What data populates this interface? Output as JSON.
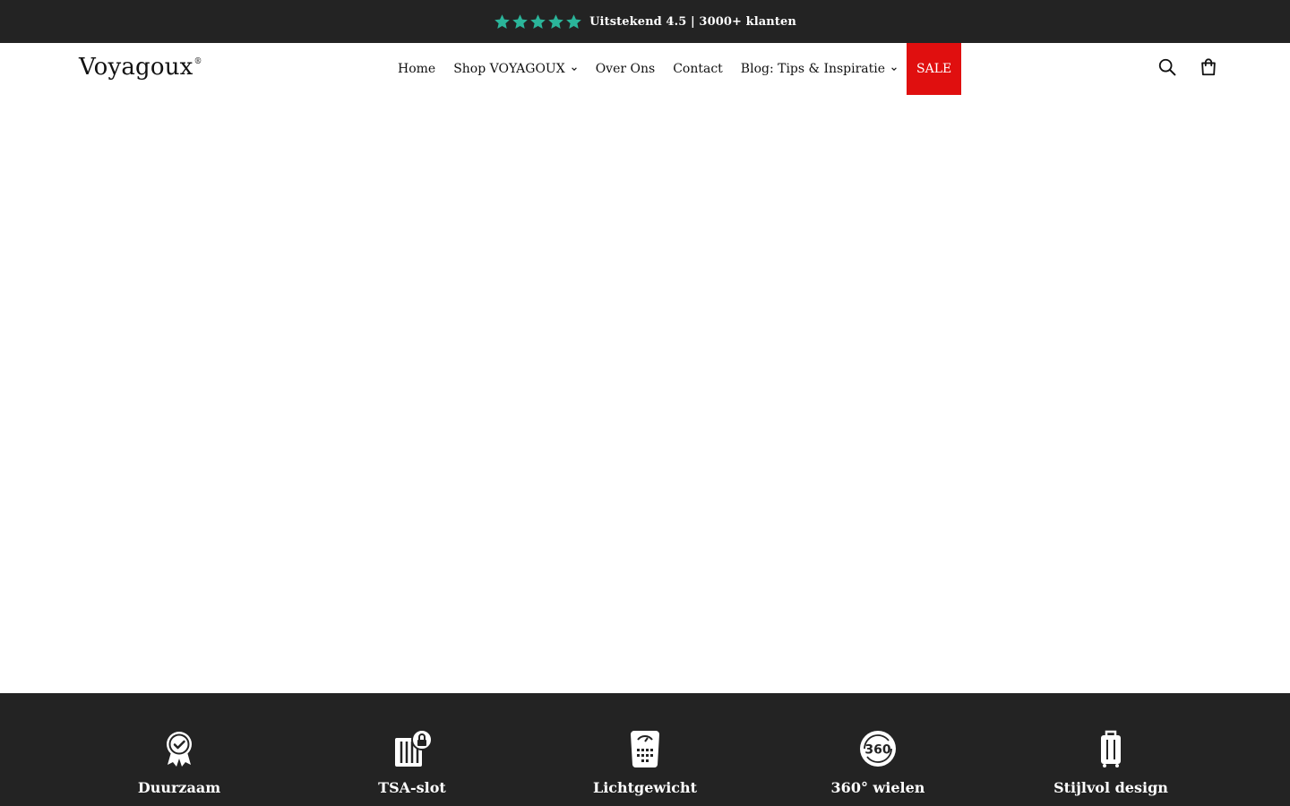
{
  "announcement": {
    "rating_stars": 5,
    "star_color": "#2bb59a",
    "text": "Uitstekend 4.5 | 3000+ klanten"
  },
  "header": {
    "logo": "Voyagoux",
    "logo_mark": "®",
    "nav": [
      {
        "label": "Home",
        "has_dropdown": false
      },
      {
        "label": "Shop VOYAGOUX",
        "has_dropdown": true
      },
      {
        "label": "Over Ons",
        "has_dropdown": false
      },
      {
        "label": "Contact",
        "has_dropdown": false
      },
      {
        "label": "Blog: Tips & Inspiratie",
        "has_dropdown": true
      },
      {
        "label": "SALE",
        "has_dropdown": false,
        "highlight_color": "#e00f0f"
      }
    ],
    "icons": [
      "search-icon",
      "shopping-bag-icon"
    ]
  },
  "features": [
    {
      "icon": "award-ribbon-icon",
      "label": "Duurzaam"
    },
    {
      "icon": "tsa-lock-icon",
      "label": "TSA-slot"
    },
    {
      "icon": "weight-scale-icon",
      "label": "Lichtgewicht"
    },
    {
      "icon": "rotate-360-icon",
      "label": "360° wielen"
    },
    {
      "icon": "suitcase-icon",
      "label": "Stijlvol design"
    }
  ],
  "colors": {
    "dark_bar": "#232323",
    "sale_red": "#e00f0f",
    "star_green": "#2bb59a"
  }
}
